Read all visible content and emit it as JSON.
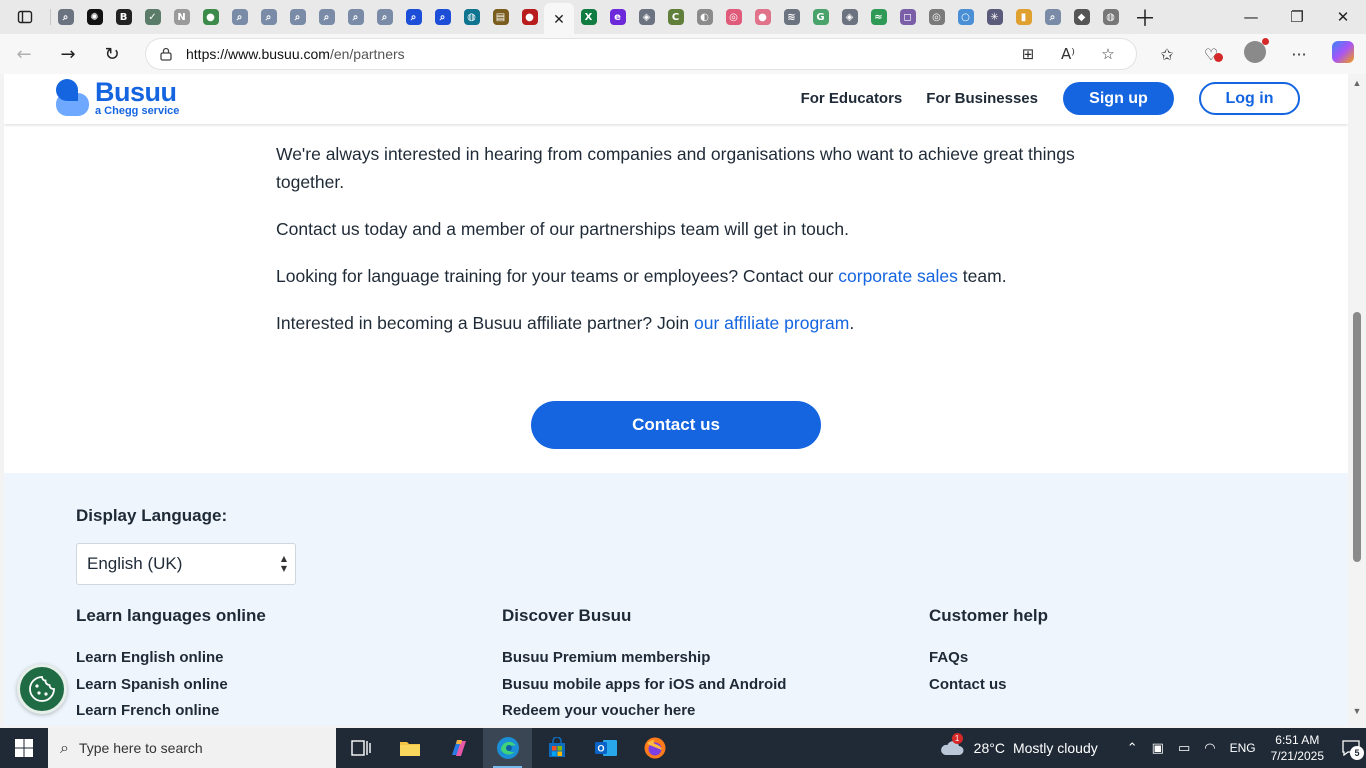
{
  "browser": {
    "tabs": [
      {
        "icon": "search-icon",
        "color": "#6b7280",
        "glyph": "⌕"
      },
      {
        "icon": "openai-icon",
        "color": "#111111",
        "glyph": "✺"
      },
      {
        "icon": "bold-b-icon",
        "color": "#222222",
        "glyph": "B"
      },
      {
        "icon": "chart-icon",
        "color": "#5c7c6a",
        "glyph": "✓"
      },
      {
        "icon": "notion-icon",
        "color": "#9a9a9a",
        "glyph": "N"
      },
      {
        "icon": "map-pin-icon",
        "color": "#3d8b4a",
        "glyph": "●"
      },
      {
        "icon": "search-icon",
        "color": "#7a8ba8",
        "glyph": "⌕"
      },
      {
        "icon": "search-icon",
        "color": "#7a8ba8",
        "glyph": "⌕"
      },
      {
        "icon": "search-icon",
        "color": "#7a8ba8",
        "glyph": "⌕"
      },
      {
        "icon": "search-icon",
        "color": "#7a8ba8",
        "glyph": "⌕"
      },
      {
        "icon": "search-icon",
        "color": "#7a8ba8",
        "glyph": "⌕"
      },
      {
        "icon": "search-icon",
        "color": "#7a8ba8",
        "glyph": "⌕"
      },
      {
        "icon": "search-icon",
        "color": "#1d4ed8",
        "glyph": "⌕"
      },
      {
        "icon": "search-icon",
        "color": "#1d4ed8",
        "glyph": "⌕"
      },
      {
        "icon": "globe-icon",
        "color": "#0e7490",
        "glyph": "◍"
      },
      {
        "icon": "notebook-icon",
        "color": "#7a5c1e",
        "glyph": "▤"
      },
      {
        "icon": "record-icon",
        "color": "#b91c1c",
        "glyph": "●"
      }
    ],
    "active_tab_close": "✕",
    "tabs_after": [
      {
        "icon": "excel-icon",
        "color": "#107c41",
        "glyph": "X"
      },
      {
        "icon": "e-icon",
        "color": "#6d28d9",
        "glyph": "e"
      },
      {
        "icon": "user-icon",
        "color": "#6b7280",
        "glyph": "◈"
      },
      {
        "icon": "c-icon",
        "color": "#5f7f3a",
        "glyph": "C"
      },
      {
        "icon": "circle-icon",
        "color": "#8b8b8b",
        "glyph": "◐"
      },
      {
        "icon": "ring-icon",
        "color": "#e05a7a",
        "glyph": "◎"
      },
      {
        "icon": "dots-icon",
        "color": "#e0728a",
        "glyph": "●"
      },
      {
        "icon": "wave-icon",
        "color": "#6b7280",
        "glyph": "≋"
      },
      {
        "icon": "g-icon",
        "color": "#4aa36a",
        "glyph": "G"
      },
      {
        "icon": "user-icon",
        "color": "#6b7280",
        "glyph": "◈"
      },
      {
        "icon": "leaf-icon",
        "color": "#2f9a55",
        "glyph": "≈"
      },
      {
        "icon": "square-icon",
        "color": "#7a5fa8",
        "glyph": "◻"
      },
      {
        "icon": "fingerprint-icon",
        "color": "#7a7a7a",
        "glyph": "◎"
      },
      {
        "icon": "circle-icon",
        "color": "#4a8fd6",
        "glyph": "○"
      },
      {
        "icon": "snowflake-icon",
        "color": "#5a5a7a",
        "glyph": "✳"
      },
      {
        "icon": "bookmark-icon",
        "color": "#e0a030",
        "glyph": "▮"
      },
      {
        "icon": "search-icon",
        "color": "#7a8ba8",
        "glyph": "⌕"
      },
      {
        "icon": "layers-icon",
        "color": "#555555",
        "glyph": "◆"
      },
      {
        "icon": "globe-icon",
        "color": "#777777",
        "glyph": "◍"
      }
    ],
    "url_host": "https://www.busuu.com",
    "url_path": "/en/partners"
  },
  "site": {
    "logo_name": "Busuu",
    "logo_sub": "a Chegg service",
    "nav": [
      "For Educators",
      "For Businesses"
    ],
    "signup_label": "Sign up",
    "login_label": "Log in"
  },
  "content": {
    "p1": "We're always interested in hearing from companies and organisations who want to achieve great things together.",
    "p2": "Contact us today and a member of our partnerships team will get in touch.",
    "p3_before": "Looking for language training for your teams or employees? Contact our ",
    "p3_link": "corporate sales",
    "p3_after": " team.",
    "p4_before": "Interested in becoming a Busuu affiliate partner? Join ",
    "p4_link": "our affiliate program",
    "p4_after": ".",
    "cta_label": "Contact us"
  },
  "footer": {
    "display_language_label": "Display Language:",
    "selected_language": "English (UK)",
    "columns": [
      {
        "title": "Learn languages online",
        "links": [
          "Learn English online",
          "Learn Spanish online",
          "Learn French online"
        ]
      },
      {
        "title": "Discover Busuu",
        "links": [
          "Busuu Premium membership",
          "Busuu mobile apps for iOS and Android",
          "Redeem your voucher here"
        ]
      },
      {
        "title": "Customer help",
        "links": [
          "FAQs",
          "Contact us"
        ]
      }
    ]
  },
  "taskbar": {
    "search_placeholder": "Type here to search",
    "weather_temp": "28°C",
    "weather_desc": "Mostly cloudy",
    "weather_badge": "1",
    "language": "ENG",
    "time": "6:51 AM",
    "date": "7/21/2025",
    "notification_count": "5"
  },
  "colors": {
    "brand": "#1565e0",
    "footer_bg": "#eff5fd",
    "taskbar_bg": "#1f2a36"
  }
}
